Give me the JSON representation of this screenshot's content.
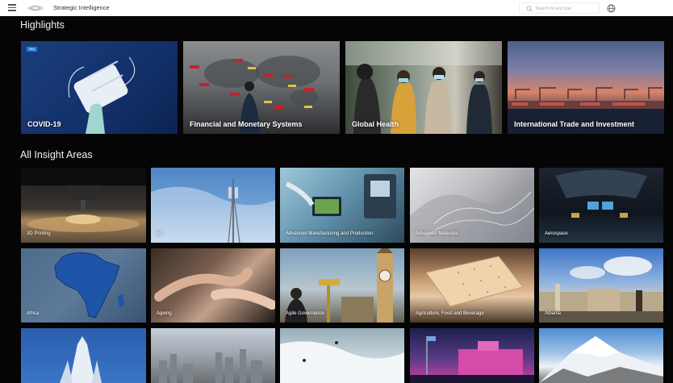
{
  "header": {
    "app_title": "Strategic Intelligence",
    "search_placeholder": "Search for any topic"
  },
  "highlights": {
    "heading": "Highlights",
    "badge_new": "New",
    "items": [
      {
        "label": "COVID-19"
      },
      {
        "label": "Financial and Monetary Systems"
      },
      {
        "label": "Global Health"
      },
      {
        "label": "International Trade and Investment"
      }
    ]
  },
  "insights": {
    "heading": "All Insight Areas",
    "items": [
      {
        "label": "3D Printing"
      },
      {
        "label": "5G"
      },
      {
        "label": "Advanced Manufacturing and Production"
      },
      {
        "label": "Advanced Materials"
      },
      {
        "label": "Aerospace"
      },
      {
        "label": "Africa"
      },
      {
        "label": "Ageing"
      },
      {
        "label": "Agile Governance"
      },
      {
        "label": "Agriculture, Food and Beverage"
      },
      {
        "label": "Albania"
      }
    ]
  },
  "colors": {
    "background": "#050505",
    "badge": "#2b7ad8",
    "topbar": "#ffffff"
  },
  "icons": {
    "menu": "hamburger-menu-icon",
    "logo": "wef-logo",
    "search": "search-icon",
    "language": "globe-icon"
  }
}
